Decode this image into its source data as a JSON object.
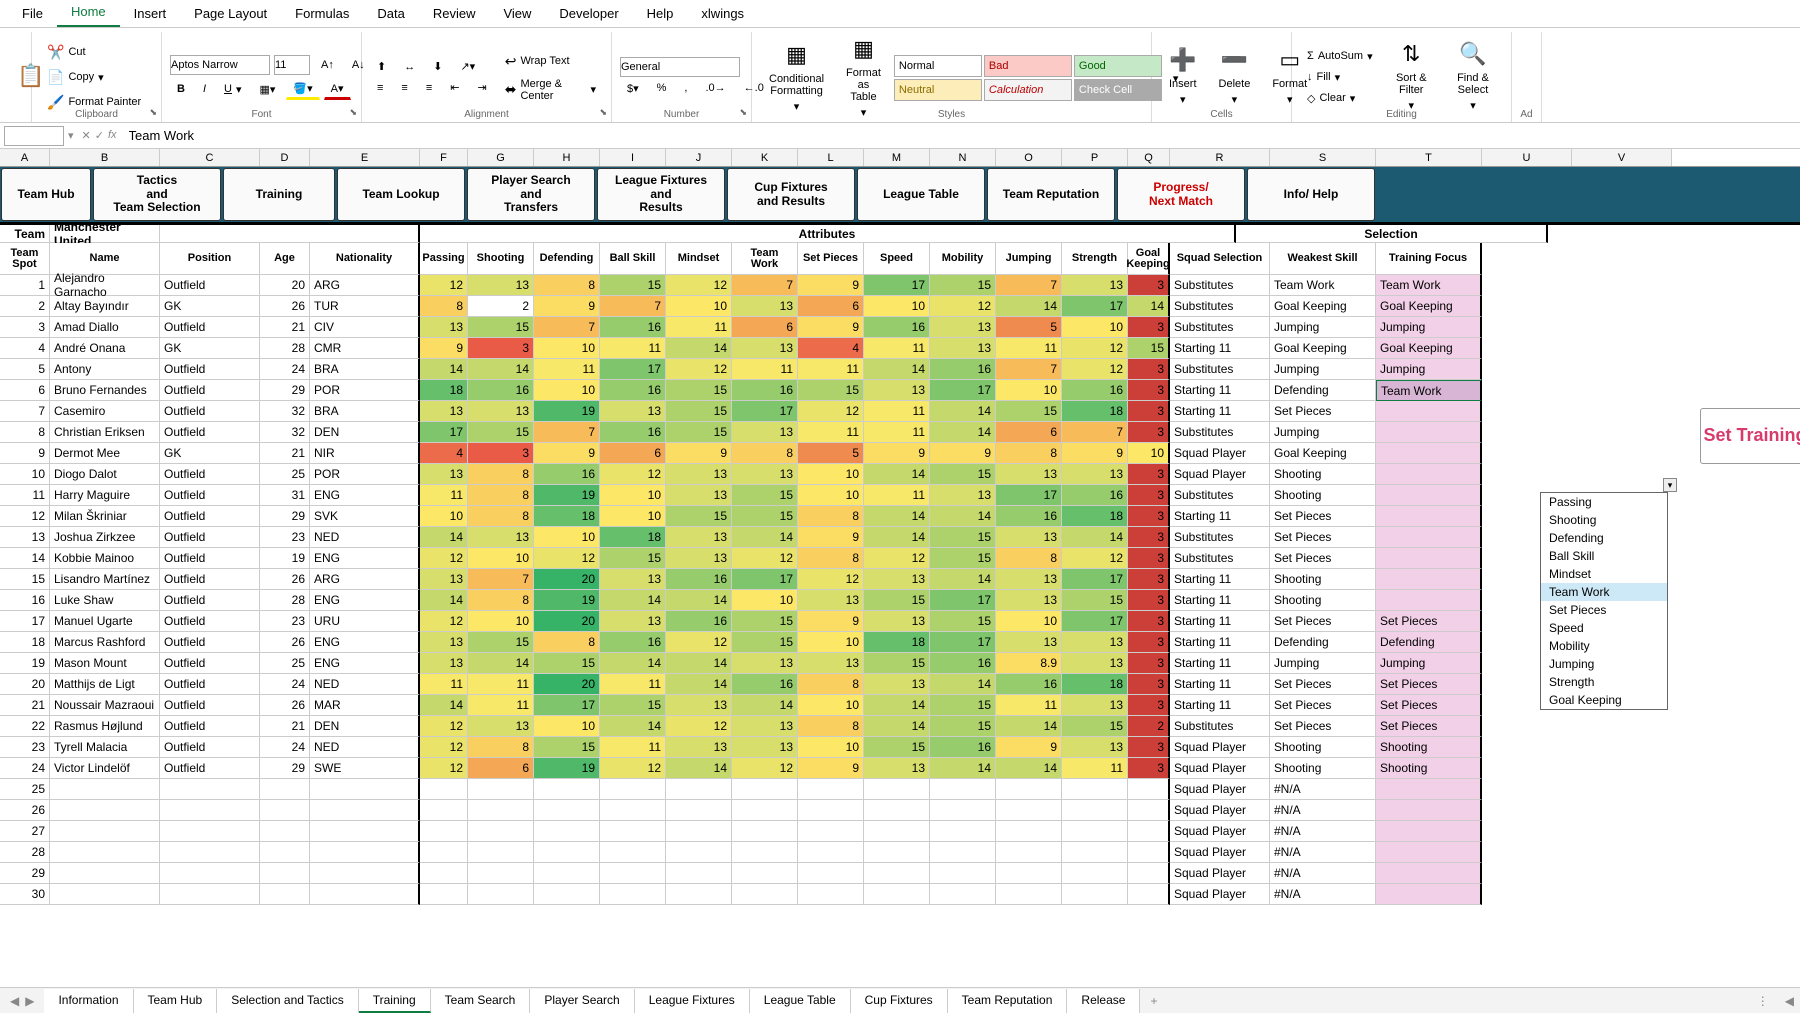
{
  "ribbon_tabs": [
    "File",
    "Home",
    "Insert",
    "Page Layout",
    "Formulas",
    "Data",
    "Review",
    "View",
    "Developer",
    "Help",
    "xlwings"
  ],
  "active_tab": 1,
  "clipboard": {
    "cut": "Cut",
    "copy": "Copy",
    "paint": "Format Painter",
    "label": "Clipboard"
  },
  "font": {
    "name": "Aptos Narrow",
    "size": "11",
    "label": "Font"
  },
  "alignment": {
    "wrap": "Wrap Text",
    "merge": "Merge & Center",
    "label": "Alignment"
  },
  "number": {
    "format": "General",
    "label": "Number"
  },
  "styles_group": {
    "cf": "Conditional Formatting",
    "ft": "Format as Table",
    "normal": "Normal",
    "bad": "Bad",
    "good": "Good",
    "neutral": "Neutral",
    "calc": "Calculation",
    "check": "Check Cell",
    "label": "Styles"
  },
  "cells": {
    "insert": "Insert",
    "delete": "Delete",
    "format": "Format",
    "label": "Cells"
  },
  "editing": {
    "sum": "AutoSum",
    "fill": "Fill",
    "clear": "Clear",
    "sort": "Sort & Filter",
    "find": "Find & Select",
    "label": "Editing"
  },
  "addins_label": "Ad",
  "formula_bar": {
    "cell": "",
    "value": "Team Work"
  },
  "cols": [
    "A",
    "B",
    "C",
    "D",
    "E",
    "F",
    "G",
    "H",
    "I",
    "J",
    "K",
    "L",
    "M",
    "N",
    "O",
    "P",
    "Q",
    "R",
    "S",
    "T",
    "U",
    "V"
  ],
  "nav_buttons": {
    "hub": "Team Hub",
    "tactics": "Tactics\nand\nTeam Selection",
    "training": "Training",
    "lookup": "Team Lookup",
    "search": "Player Search\nand\nTransfers",
    "league": "League Fixtures\nand\nResults",
    "cup": "Cup Fixtures\nand Results",
    "table": "League Table",
    "rep": "Team Reputation",
    "progress": "Progress/\nNext Match",
    "info": "Info/ Help"
  },
  "team_label": "Team",
  "team_name": "Manchester United",
  "attr_span": "Attributes",
  "sel_span": "Selection",
  "headers": {
    "spot": "Team Spot",
    "name": "Name",
    "pos": "Position",
    "age": "Age",
    "nat": "Nationality",
    "passing": "Passing",
    "shooting": "Shooting",
    "defending": "Defending",
    "ball": "Ball Skill",
    "mindset": "Mindset",
    "team": "Team Work",
    "set": "Set Pieces",
    "speed": "Speed",
    "mob": "Mobility",
    "jump": "Jumping",
    "str": "Strength",
    "goal": "Goal Keeping",
    "squad": "Squad Selection",
    "weak": "Weakest Skill",
    "focus": "Training Focus"
  },
  "set_training": "Set Training",
  "dropdown_options": [
    "Passing",
    "Shooting",
    "Defending",
    "Ball Skill",
    "Mindset",
    "Team Work",
    "Set Pieces",
    "Speed",
    "Mobility",
    "Jumping",
    "Strength",
    "Goal Keeping"
  ],
  "dropdown_selected": "Team Work",
  "rows": [
    {
      "n": 1,
      "name": "Alejandro Garnacho",
      "pos": "Outfield",
      "age": 20,
      "nat": "ARG",
      "a": [
        12,
        13,
        8,
        15,
        12,
        7,
        9,
        17,
        15,
        7,
        13,
        3
      ],
      "sq": "Substitutes",
      "wk": "Team Work",
      "tf": "Team Work"
    },
    {
      "n": 2,
      "name": "Altay Bayındır",
      "pos": "GK",
      "age": 26,
      "nat": "TUR",
      "a": [
        8,
        2,
        9,
        7,
        10,
        13,
        6,
        10,
        12,
        14,
        17,
        14
      ],
      "sq": "Substitutes",
      "wk": "Goal Keeping",
      "tf": "Goal Keeping"
    },
    {
      "n": 3,
      "name": "Amad Diallo",
      "pos": "Outfield",
      "age": 21,
      "nat": "CIV",
      "a": [
        13,
        15,
        7,
        16,
        11,
        6,
        9,
        16,
        13,
        5,
        10,
        3
      ],
      "sq": "Substitutes",
      "wk": "Jumping",
      "tf": "Jumping"
    },
    {
      "n": 4,
      "name": "André Onana",
      "pos": "GK",
      "age": 28,
      "nat": "CMR",
      "a": [
        9,
        3,
        10,
        11,
        14,
        13,
        4,
        11,
        13,
        11,
        12,
        15
      ],
      "sq": "Starting 11",
      "wk": "Goal Keeping",
      "tf": "Goal Keeping"
    },
    {
      "n": 5,
      "name": "Antony",
      "pos": "Outfield",
      "age": 24,
      "nat": "BRA",
      "a": [
        14,
        14,
        11,
        17,
        12,
        11,
        11,
        14,
        16,
        7,
        12,
        3
      ],
      "sq": "Substitutes",
      "wk": "Jumping",
      "tf": "Jumping"
    },
    {
      "n": 6,
      "name": "Bruno Fernandes",
      "pos": "Outfield",
      "age": 29,
      "nat": "POR",
      "a": [
        18,
        16,
        10,
        16,
        15,
        16,
        15,
        13,
        17,
        10,
        16,
        3
      ],
      "sq": "Starting 11",
      "wk": "Defending",
      "tf": "Team Work"
    },
    {
      "n": 7,
      "name": "Casemiro",
      "pos": "Outfield",
      "age": 32,
      "nat": "BRA",
      "a": [
        13,
        13,
        19,
        13,
        15,
        17,
        12,
        11,
        14,
        15,
        18,
        3
      ],
      "sq": "Starting 11",
      "wk": "Set Pieces",
      "tf": ""
    },
    {
      "n": 8,
      "name": "Christian Eriksen",
      "pos": "Outfield",
      "age": 32,
      "nat": "DEN",
      "a": [
        17,
        15,
        7,
        16,
        15,
        13,
        11,
        11,
        14,
        6,
        7,
        3
      ],
      "sq": "Substitutes",
      "wk": "Jumping",
      "tf": ""
    },
    {
      "n": 9,
      "name": "Dermot Mee",
      "pos": "GK",
      "age": 21,
      "nat": "NIR",
      "a": [
        4,
        3,
        9,
        6,
        9,
        8,
        5,
        9,
        9,
        8,
        9,
        10
      ],
      "sq": "Squad Player",
      "wk": "Goal Keeping",
      "tf": ""
    },
    {
      "n": 10,
      "name": "Diogo Dalot",
      "pos": "Outfield",
      "age": 25,
      "nat": "POR",
      "a": [
        13,
        8,
        16,
        12,
        13,
        13,
        10,
        14,
        15,
        13,
        13,
        3
      ],
      "sq": "Squad Player",
      "wk": "Shooting",
      "tf": ""
    },
    {
      "n": 11,
      "name": "Harry Maguire",
      "pos": "Outfield",
      "age": 31,
      "nat": "ENG",
      "a": [
        11,
        8,
        19,
        10,
        13,
        15,
        10,
        11,
        13,
        17,
        16,
        3
      ],
      "sq": "Substitutes",
      "wk": "Shooting",
      "tf": ""
    },
    {
      "n": 12,
      "name": "Milan Škriniar",
      "pos": "Outfield",
      "age": 29,
      "nat": "SVK",
      "a": [
        10,
        8,
        18,
        10,
        15,
        15,
        8,
        14,
        14,
        16,
        18,
        3
      ],
      "sq": "Starting 11",
      "wk": "Set Pieces",
      "tf": ""
    },
    {
      "n": 13,
      "name": "Joshua Zirkzee",
      "pos": "Outfield",
      "age": 23,
      "nat": "NED",
      "a": [
        14,
        13,
        10,
        18,
        13,
        14,
        9,
        14,
        15,
        13,
        14,
        3
      ],
      "sq": "Substitutes",
      "wk": "Set Pieces",
      "tf": ""
    },
    {
      "n": 14,
      "name": "Kobbie Mainoo",
      "pos": "Outfield",
      "age": 19,
      "nat": "ENG",
      "a": [
        12,
        10,
        12,
        15,
        13,
        12,
        8,
        12,
        15,
        8,
        12,
        3
      ],
      "sq": "Substitutes",
      "wk": "Set Pieces",
      "tf": ""
    },
    {
      "n": 15,
      "name": "Lisandro Martínez",
      "pos": "Outfield",
      "age": 26,
      "nat": "ARG",
      "a": [
        13,
        7,
        20,
        13,
        16,
        17,
        12,
        13,
        14,
        13,
        17,
        3
      ],
      "sq": "Starting 11",
      "wk": "Shooting",
      "tf": ""
    },
    {
      "n": 16,
      "name": "Luke Shaw",
      "pos": "Outfield",
      "age": 28,
      "nat": "ENG",
      "a": [
        14,
        8,
        19,
        14,
        14,
        10,
        13,
        15,
        17,
        13,
        15,
        3
      ],
      "sq": "Starting 11",
      "wk": "Shooting",
      "tf": ""
    },
    {
      "n": 17,
      "name": "Manuel Ugarte",
      "pos": "Outfield",
      "age": 23,
      "nat": "URU",
      "a": [
        12,
        10,
        20,
        13,
        16,
        15,
        9,
        13,
        15,
        10,
        17,
        3
      ],
      "sq": "Starting 11",
      "wk": "Set Pieces",
      "tf": "Set Pieces"
    },
    {
      "n": 18,
      "name": "Marcus Rashford",
      "pos": "Outfield",
      "age": 26,
      "nat": "ENG",
      "a": [
        13,
        15,
        8,
        16,
        12,
        15,
        10,
        18,
        17,
        13,
        13,
        3
      ],
      "sq": "Starting 11",
      "wk": "Defending",
      "tf": "Defending"
    },
    {
      "n": 19,
      "name": "Mason Mount",
      "pos": "Outfield",
      "age": 25,
      "nat": "ENG",
      "a": [
        13,
        14,
        15,
        14,
        14,
        13,
        13,
        15,
        16,
        8.9,
        13,
        3
      ],
      "sq": "Starting 11",
      "wk": "Jumping",
      "tf": "Jumping"
    },
    {
      "n": 20,
      "name": "Matthijs de Ligt",
      "pos": "Outfield",
      "age": 24,
      "nat": "NED",
      "a": [
        11,
        11,
        20,
        11,
        14,
        16,
        8,
        13,
        14,
        16,
        18,
        3
      ],
      "sq": "Starting 11",
      "wk": "Set Pieces",
      "tf": "Set Pieces"
    },
    {
      "n": 21,
      "name": "Noussair Mazraoui",
      "pos": "Outfield",
      "age": 26,
      "nat": "MAR",
      "a": [
        14,
        11,
        17,
        15,
        13,
        14,
        10,
        14,
        15,
        11,
        13,
        3
      ],
      "sq": "Starting 11",
      "wk": "Set Pieces",
      "tf": "Set Pieces"
    },
    {
      "n": 22,
      "name": "Rasmus Højlund",
      "pos": "Outfield",
      "age": 21,
      "nat": "DEN",
      "a": [
        12,
        13,
        10,
        14,
        12,
        13,
        8,
        14,
        15,
        14,
        15,
        2
      ],
      "sq": "Substitutes",
      "wk": "Set Pieces",
      "tf": "Set Pieces"
    },
    {
      "n": 23,
      "name": "Tyrell Malacia",
      "pos": "Outfield",
      "age": 24,
      "nat": "NED",
      "a": [
        12,
        8,
        15,
        11,
        13,
        13,
        10,
        15,
        16,
        9,
        13,
        3
      ],
      "sq": "Squad Player",
      "wk": "Shooting",
      "tf": "Shooting"
    },
    {
      "n": 24,
      "name": "Victor Lindelöf",
      "pos": "Outfield",
      "age": 29,
      "nat": "SWE",
      "a": [
        12,
        6,
        19,
        12,
        14,
        12,
        9,
        13,
        14,
        14,
        11,
        3
      ],
      "sq": "Squad Player",
      "wk": "Shooting",
      "tf": "Shooting"
    }
  ],
  "extra_rows": [
    25,
    26,
    27,
    28,
    29,
    30
  ],
  "na_rows": [
    "#N/A",
    "#N/A",
    "#N/A",
    "#N/A",
    "#N/A",
    "#N/A"
  ],
  "na_squad": "Squad Player",
  "sheet_tabs": [
    "Information",
    "Team Hub",
    "Selection and Tactics",
    "Training",
    "Team Search",
    "Player Search",
    "League Fixtures",
    "League Table",
    "Cup Fixtures",
    "Team Reputation",
    "Release"
  ],
  "active_sheet": 3,
  "chart_data": null
}
